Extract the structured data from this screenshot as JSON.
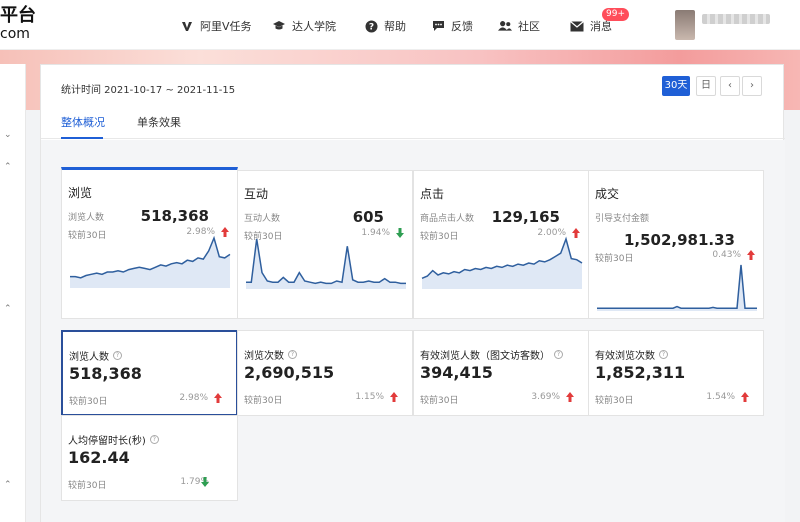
{
  "brand": {
    "name_line1": "平台",
    "name_line2": "com"
  },
  "nav": {
    "items": [
      {
        "label": "阿里V任务",
        "icon": "v-logo-icon"
      },
      {
        "label": "达人学院",
        "icon": "graduation-cap-icon"
      },
      {
        "label": "帮助",
        "icon": "question-icon"
      },
      {
        "label": "反馈",
        "icon": "chat-icon"
      },
      {
        "label": "社区",
        "icon": "users-icon"
      },
      {
        "label": "消息",
        "icon": "mail-icon"
      }
    ],
    "badge": "99+"
  },
  "toolbar": {
    "period": "统计时间 2021-10-17 ~ 2021-11-15",
    "btn_30": "30天",
    "btn_day": "日",
    "prev": "‹",
    "next": "›"
  },
  "tabs": [
    {
      "label": "整体概况"
    },
    {
      "label": "单条效果"
    }
  ],
  "metrics": [
    {
      "title": "浏览",
      "sub": "浏览人数",
      "value": "518,368",
      "cmp": "较前30日",
      "pct": "2.98%",
      "trend": "up",
      "spark": [
        8,
        8,
        7,
        9,
        10,
        11,
        10,
        12,
        12,
        13,
        12,
        14,
        15,
        16,
        15,
        14,
        16,
        18,
        17,
        19,
        20,
        19,
        22,
        21,
        24,
        23,
        30,
        41,
        25,
        24,
        27
      ]
    },
    {
      "title": "互动",
      "sub": "互动人数",
      "value": "605",
      "cmp": "较前30日",
      "pct": "1.94%",
      "trend": "down",
      "spark": [
        4,
        4,
        40,
        12,
        5,
        4,
        4,
        8,
        4,
        4,
        12,
        5,
        4,
        3,
        4,
        3,
        3,
        5,
        4,
        34,
        6,
        4,
        4,
        5,
        4,
        4,
        7,
        4,
        4,
        3,
        3
      ]
    },
    {
      "title": "点击",
      "sub": "商品点击人数",
      "value": "129,165",
      "cmp": "较前30日",
      "pct": "2.00%",
      "trend": "up",
      "spark": [
        8,
        10,
        15,
        11,
        13,
        12,
        14,
        13,
        16,
        15,
        17,
        16,
        18,
        17,
        19,
        18,
        20,
        19,
        21,
        20,
        22,
        21,
        24,
        23,
        25,
        28,
        31,
        44,
        26,
        25,
        22
      ]
    },
    {
      "title": "成交",
      "sub": "引导支付金额",
      "value": "1,502,981.33",
      "cmp": "较前30日",
      "pct": "0.43%",
      "trend": "up",
      "spark": [
        1,
        1,
        1,
        1,
        1,
        1,
        1,
        1,
        1,
        1,
        1,
        1,
        1,
        1,
        1,
        1,
        1,
        1,
        1,
        1,
        3,
        1,
        1,
        1,
        1,
        1,
        1,
        1,
        1,
        2,
        1,
        1,
        1,
        1,
        1,
        1,
        55,
        1,
        1,
        1,
        1
      ]
    }
  ],
  "bottom_metrics": [
    {
      "title": "浏览人数",
      "value": "518,368",
      "cmp": "较前30日",
      "pct": "2.98%",
      "trend": "up"
    },
    {
      "title": "浏览次数",
      "value": "2,690,515",
      "cmp": "较前30日",
      "pct": "1.15%",
      "trend": "up"
    },
    {
      "title": "有效浏览人数（图文访客数）",
      "value": "394,415",
      "cmp": "较前30日",
      "pct": "3.69%",
      "trend": "up"
    },
    {
      "title": "有效浏览次数",
      "value": "1,852,311",
      "cmp": "较前30日",
      "pct": "1.54%",
      "trend": "up"
    },
    {
      "title": "人均停留时长(秒)",
      "value": "162.44",
      "cmp": "较前30日",
      "pct": "1.79%",
      "trend": "down"
    }
  ],
  "colors": {
    "accent": "#1f5fd6",
    "up": "#e23b3b",
    "down": "#2e9e52",
    "line": "#2f5f9e",
    "area": "#dfe8f5"
  }
}
